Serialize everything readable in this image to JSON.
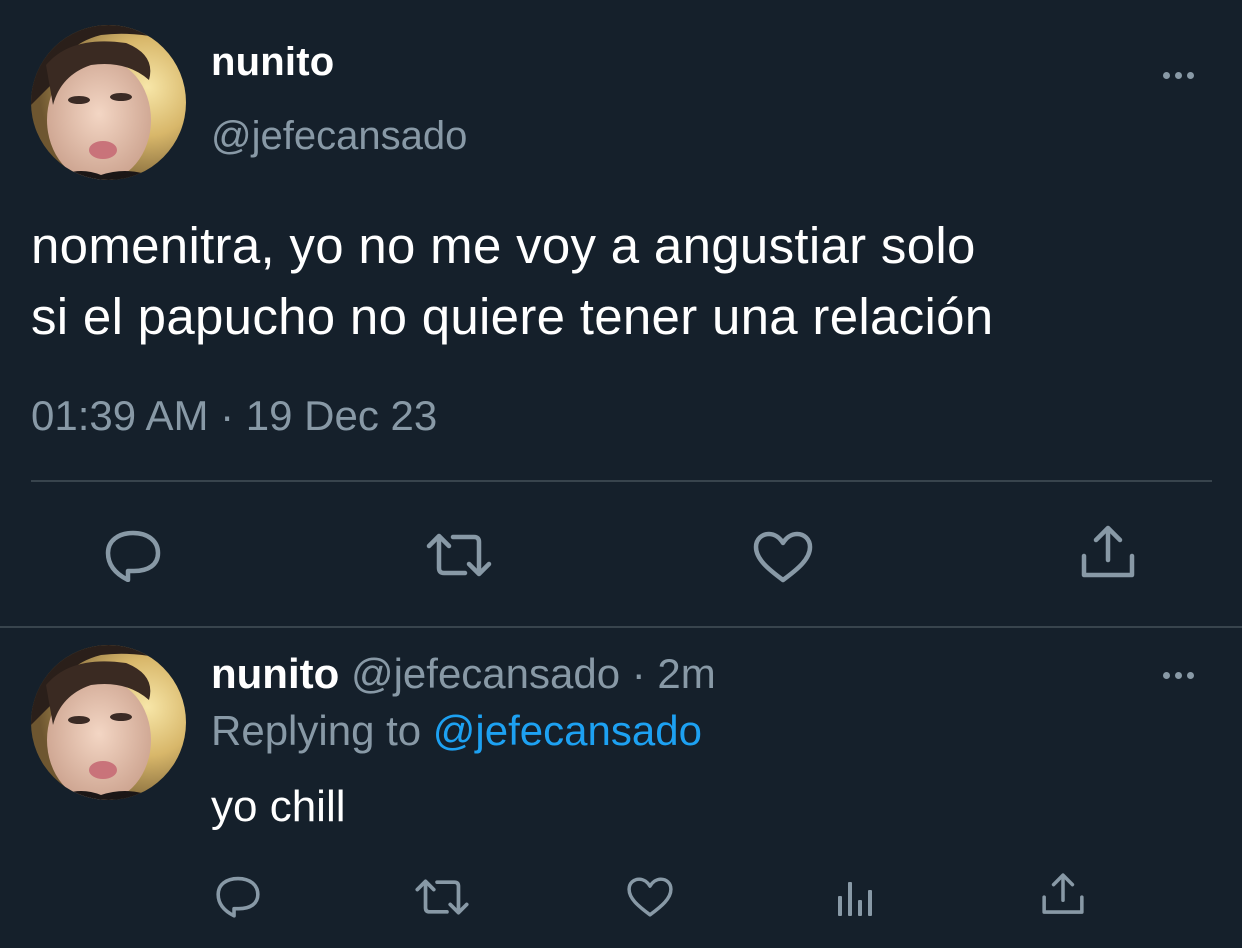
{
  "main_tweet": {
    "display_name": "nunito",
    "handle": "@jefecansado",
    "text_line1": "nomenitra, yo no me voy a angustiar solo",
    "text_line2": "si el papucho no quiere tener una relación",
    "timestamp": "01:39 AM · 19 Dec 23",
    "actions": [
      "reply-icon",
      "retweet-icon",
      "like-icon",
      "share-icon"
    ]
  },
  "reply_tweet": {
    "display_name": "nunito",
    "meta": "@jefecansado · 2m",
    "replying_prefix": "Replying to",
    "replying_handle": "@jefecansado",
    "text": "yo chill",
    "actions": [
      "reply-icon",
      "retweet-icon",
      "like-icon",
      "analytics-icon",
      "share-icon"
    ]
  },
  "colors": {
    "background": "#15202b",
    "primary_text": "#ffffff",
    "secondary_text": "#8899a6",
    "link": "#1da1f2",
    "divider": "#38444d"
  }
}
